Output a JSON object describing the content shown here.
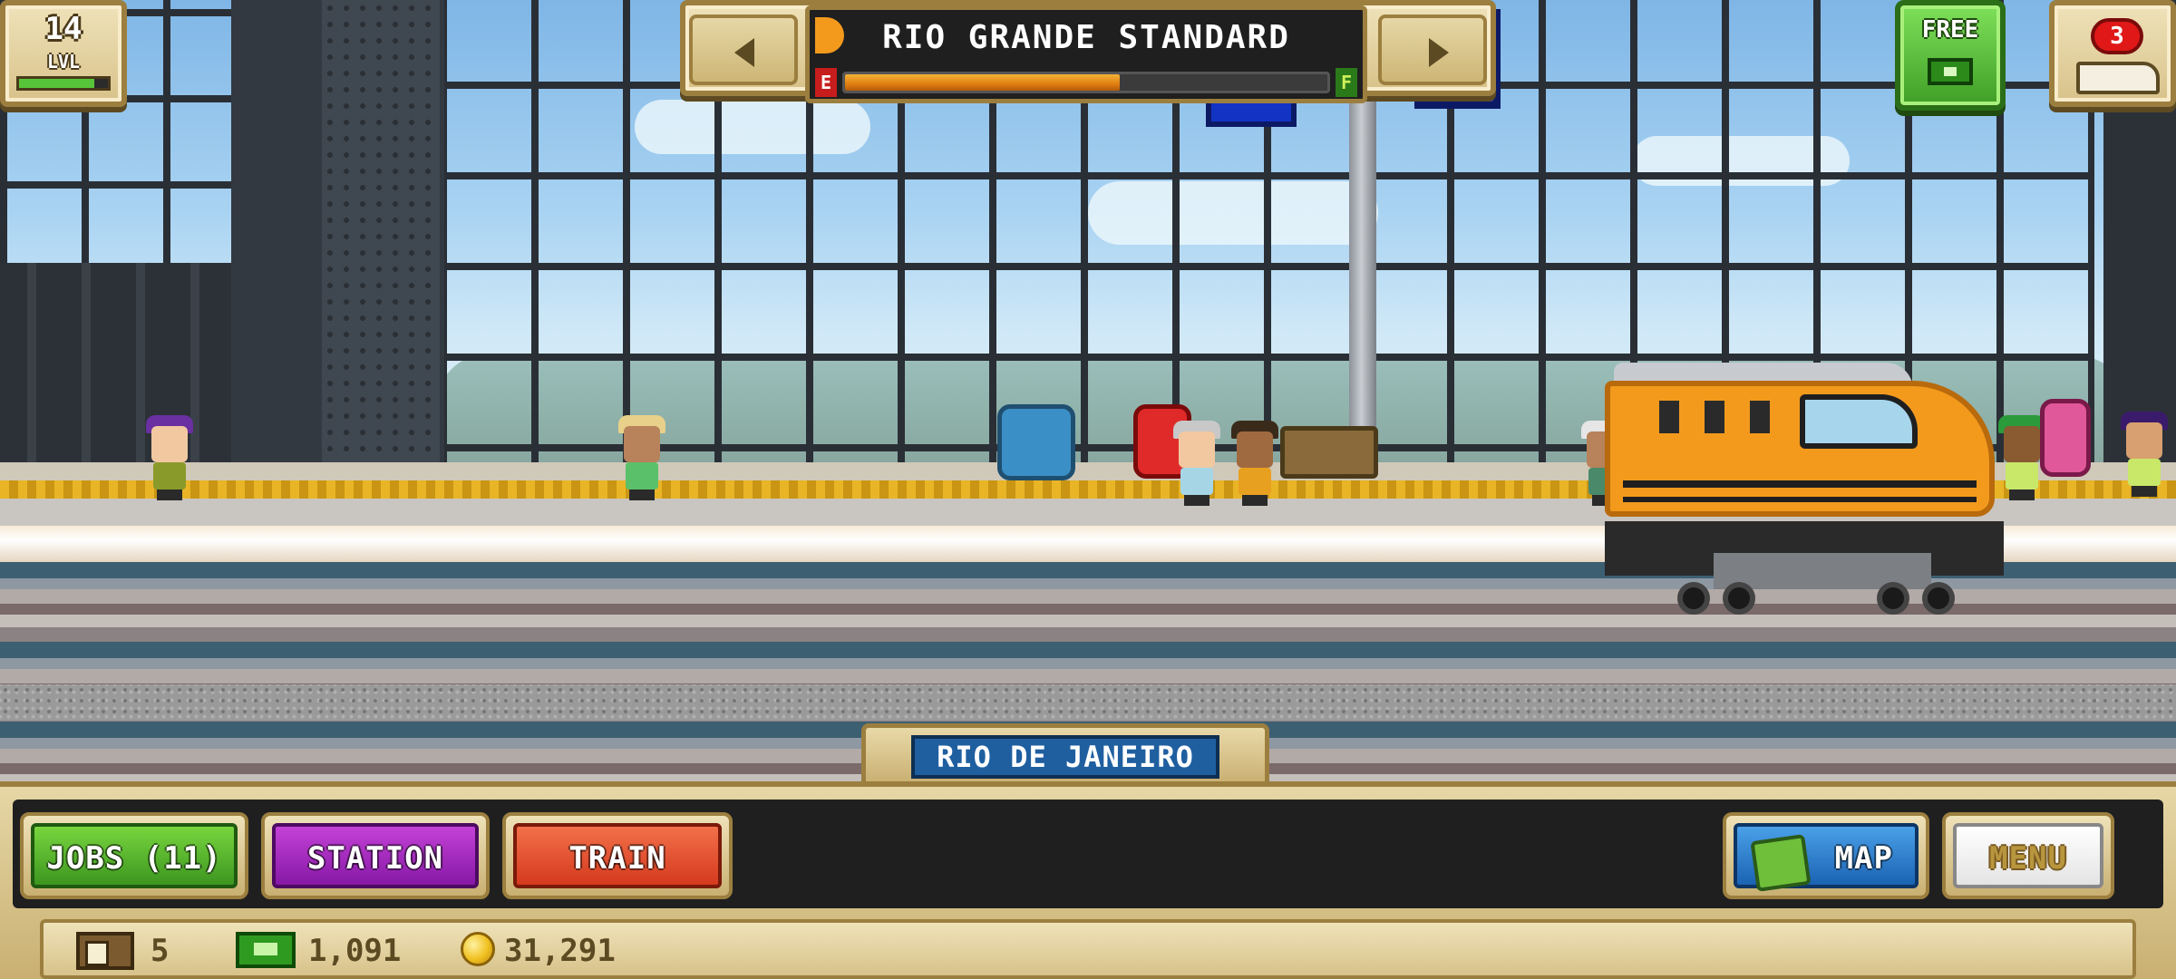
{
  "hud": {
    "level": {
      "number": "14",
      "label": "LVL",
      "xp_progress": 0.85
    },
    "train_selector": {
      "train_name": "RIO GRANDE STANDARD",
      "fuel_empty_label": "E",
      "fuel_full_label": "F",
      "fuel_level": 0.57
    },
    "free_offer": {
      "label": "FREE"
    },
    "trains": {
      "badge_count": "3"
    }
  },
  "station": {
    "name": "RIO DE JANEIRO"
  },
  "bottom_bar": {
    "jobs_label": "JOBS (11)",
    "station_label": "STATION",
    "train_label": "TRAIN",
    "map_label": "MAP",
    "menu_label": "MENU"
  },
  "resources": {
    "crates": "5",
    "cash": "1,091",
    "coins": "31,291"
  },
  "colors": {
    "jobs": "#3d9520",
    "station": "#8718a6",
    "train": "#d53a1e",
    "map": "#1b63b3",
    "locomotive": "#f39a1d",
    "station_plate": "#1f5fa0"
  },
  "icons": [
    "crate-icon",
    "cash-icon",
    "coin-icon",
    "map-icon",
    "locomotive-icon"
  ]
}
